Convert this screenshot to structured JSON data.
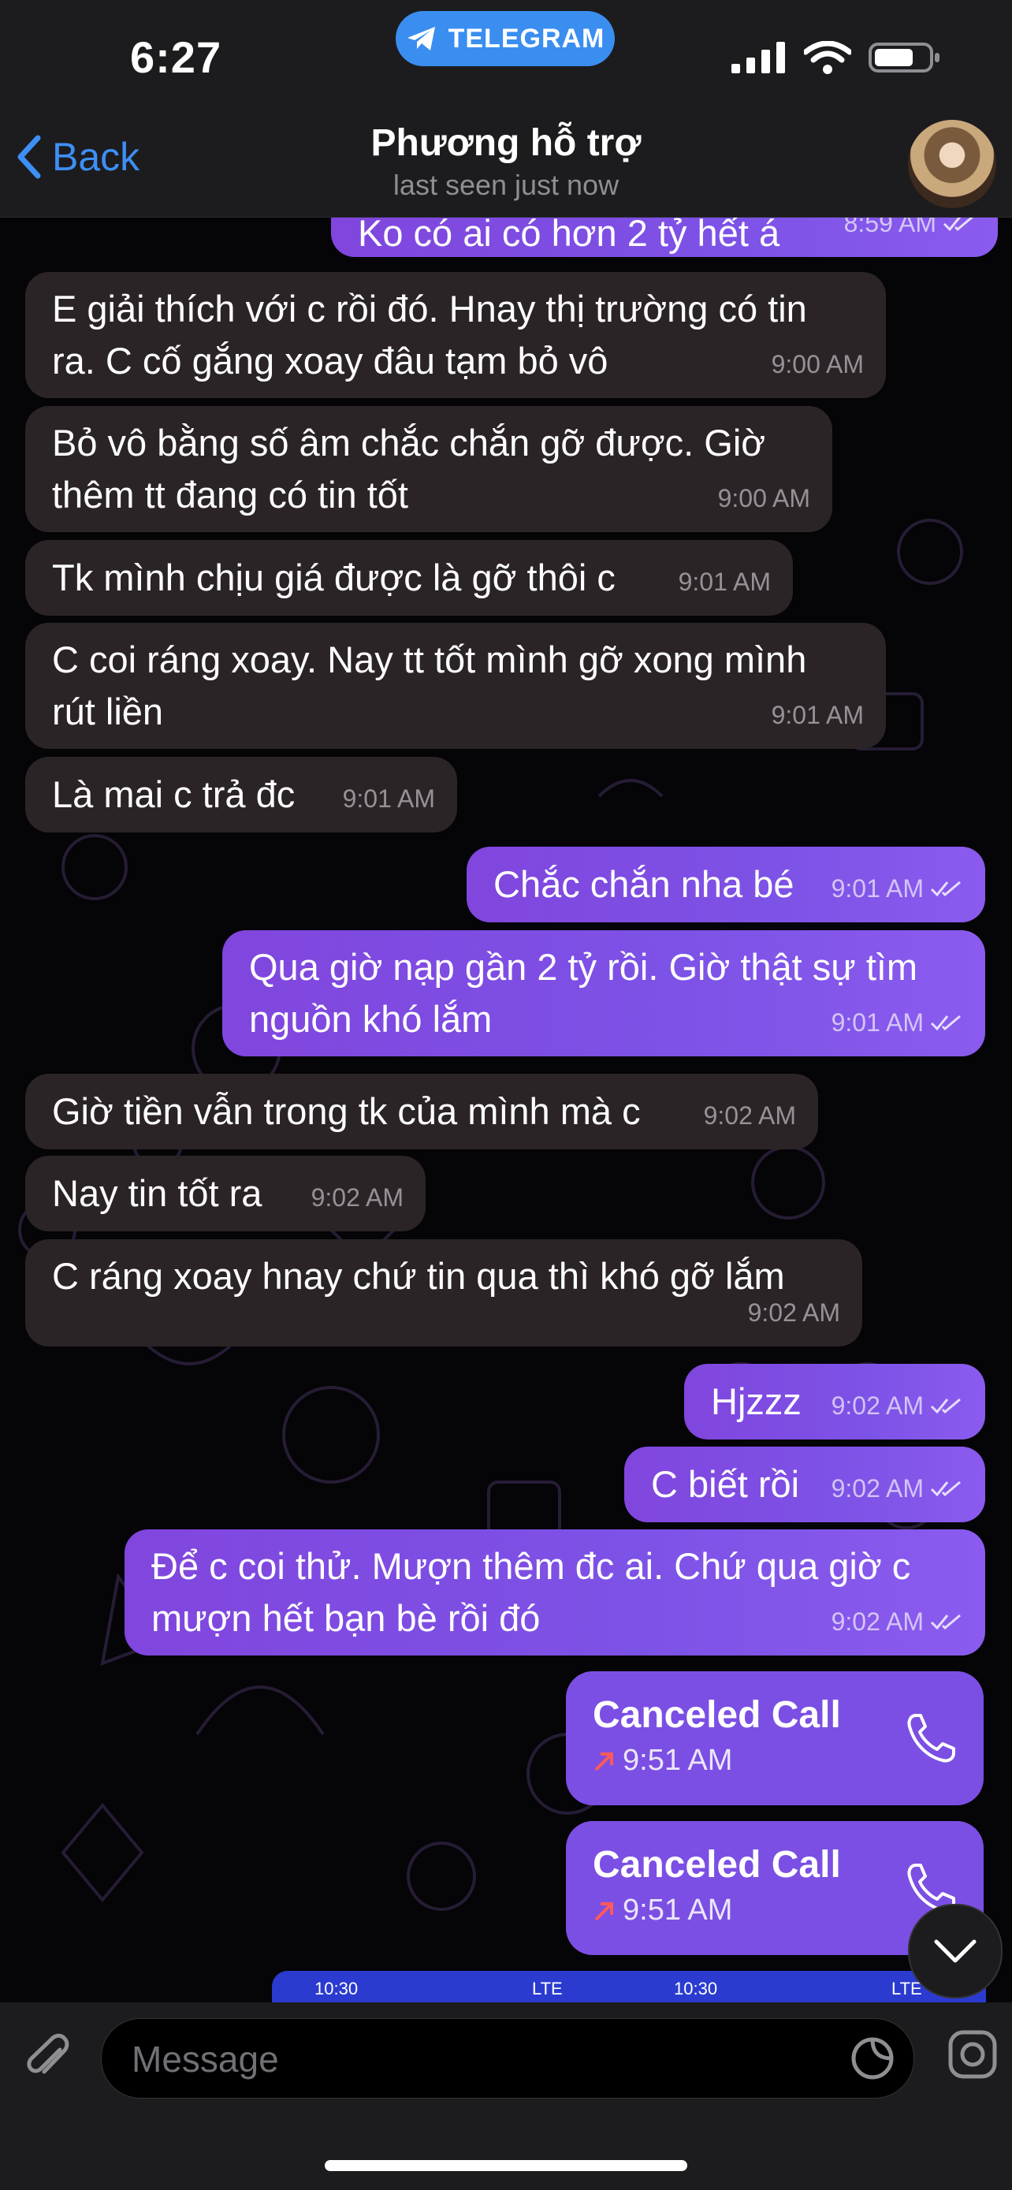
{
  "status_bar": {
    "time": "6:27",
    "telegram_pill": "TELEGRAM"
  },
  "nav": {
    "back_label": "Back",
    "title": "Phương hỗ trợ",
    "subtitle": "last seen just now"
  },
  "messages": [
    {
      "dir": "out",
      "text": "Ko có ai có hơn 2 tỷ hết á",
      "time": "8:59 AM"
    },
    {
      "dir": "in",
      "text": "E giải thích với c rồi đó. Hnay thị trường có tin\nra. C cố gắng xoay đâu tạm bỏ vô",
      "time": "9:00 AM"
    },
    {
      "dir": "in",
      "text": "Bỏ vô bằng số âm chắc chắn gỡ được. Giờ\nthêm tt đang có tin tốt",
      "time": "9:00 AM"
    },
    {
      "dir": "in",
      "text": "Tk mình chịu giá được là gỡ thôi c",
      "time": "9:01 AM"
    },
    {
      "dir": "in",
      "text": "C coi ráng xoay. Nay tt tốt mình gỡ xong mình\nrút liền",
      "time": "9:01 AM"
    },
    {
      "dir": "in",
      "text": "Là mai c trả đc",
      "time": "9:01 AM"
    },
    {
      "dir": "out",
      "text": "Chắc chắn nha bé",
      "time": "9:01 AM"
    },
    {
      "dir": "out",
      "text": "Qua giờ nạp gần 2 tỷ rồi. Giờ thật sự tìm\nnguồn khó lắm",
      "time": "9:01 AM"
    },
    {
      "dir": "in",
      "text": "Giờ tiền vẫn trong tk của mình mà c",
      "time": "9:02 AM"
    },
    {
      "dir": "in",
      "text": "Nay tin tốt ra",
      "time": "9:02 AM"
    },
    {
      "dir": "in",
      "text": "C ráng xoay hnay chứ tin qua thì khó gỡ lắm",
      "time": "9:02 AM"
    },
    {
      "dir": "out",
      "text": "Hjzzz",
      "time": "9:02 AM"
    },
    {
      "dir": "out",
      "text": "C biết rồi",
      "time": "9:02 AM"
    },
    {
      "dir": "out",
      "text": "Để c coi thử. Mượn thêm đc ai. Chứ qua giờ c\nmượn hết bạn bè rồi đó",
      "time": "9:02 AM"
    }
  ],
  "calls": [
    {
      "title": "Canceled Call",
      "time": "9:51 AM"
    },
    {
      "title": "Canceled Call",
      "time": "9:51 AM"
    }
  ],
  "preview": {
    "time_left": "10:30",
    "time_right": "10:30",
    "network": "LTE"
  },
  "input": {
    "placeholder": "Message"
  },
  "colors": {
    "accent": "#3e8ff5",
    "outgoing": "#7d52e6",
    "incoming": "#2b2426"
  }
}
